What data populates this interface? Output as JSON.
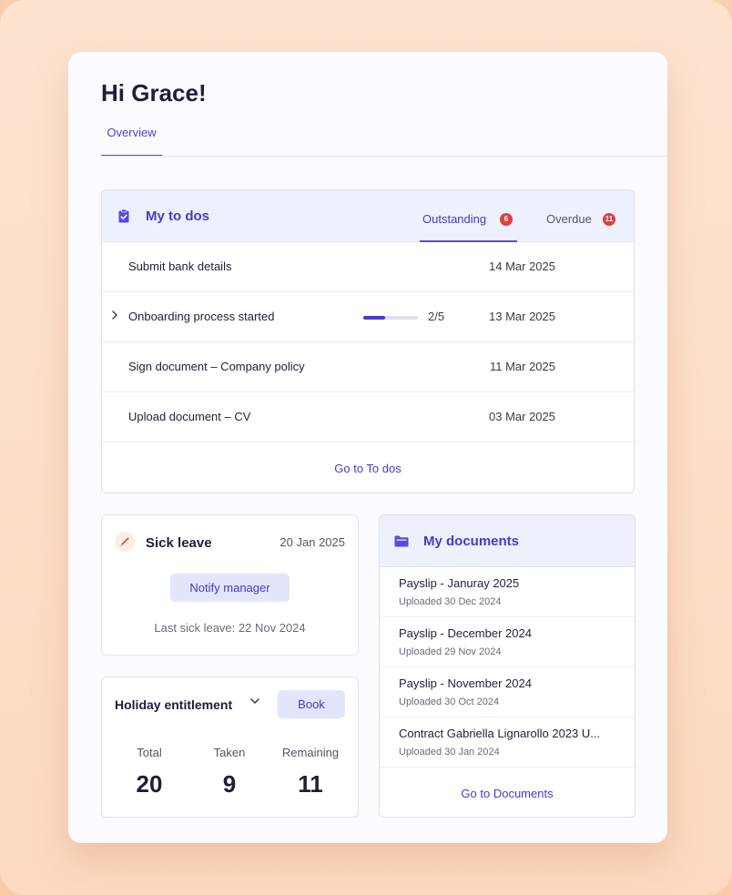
{
  "greeting": "Hi Grace!",
  "tabs": [
    {
      "label": "Overview",
      "active": true
    }
  ],
  "todos": {
    "title": "My to dos",
    "icon": "clipboard-check-icon",
    "tabs": [
      {
        "label": "Outstanding",
        "count": "6",
        "active": true
      },
      {
        "label": "Overdue",
        "count": "11",
        "active": false
      }
    ],
    "items": [
      {
        "text": "Submit bank details",
        "date": "14 Mar 2025"
      },
      {
        "text": "Onboarding process started",
        "date": "13 Mar 2025",
        "progress_text": "2/5",
        "progress": 0.4,
        "expandable": true
      },
      {
        "text": "Sign document – Company policy",
        "date": "11 Mar 2025"
      },
      {
        "text": "Upload document – CV",
        "date": "03 Mar 2025"
      }
    ],
    "link": "Go to To dos"
  },
  "sick_leave": {
    "icon": "pencil-icon",
    "title": "Sick leave",
    "date": "20 Jan 2025",
    "button": "Notify manager",
    "last": "Last sick leave: 22 Nov 2024"
  },
  "holiday": {
    "title": "Holiday entitlement",
    "button": "Book",
    "stats": [
      {
        "label": "Total",
        "value": "20"
      },
      {
        "label": "Taken",
        "value": "9"
      },
      {
        "label": "Remaining",
        "value": "11"
      }
    ]
  },
  "documents": {
    "icon": "folder-icon",
    "title": "My documents",
    "items": [
      {
        "name": "Payslip - Januray 2025",
        "meta": "Uploaded 30 Dec 2024"
      },
      {
        "name": "Payslip - December  2024",
        "meta": "Uploaded 29 Nov  2024"
      },
      {
        "name": "Payslip - November 2024",
        "meta": "Uploaded 30 Oct 2024"
      },
      {
        "name": "Contract Gabriella Lignarollo 2023 U...",
        "meta": "Uploaded 30 Jan 2024"
      }
    ],
    "link": "Go to Documents"
  },
  "colors": {
    "accent": "#4a38c9",
    "badge": "#e23d3d",
    "header_bg": "#eef0fd"
  }
}
